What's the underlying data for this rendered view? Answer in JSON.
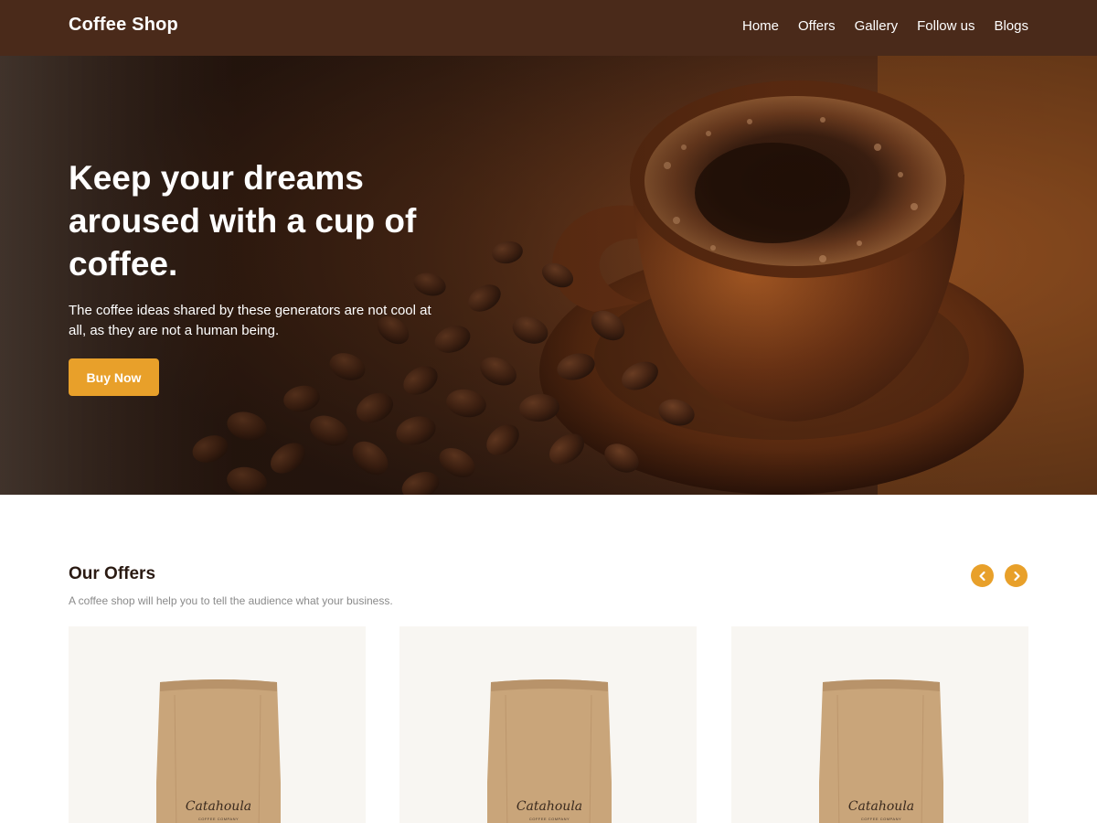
{
  "header": {
    "brand": "Coffee Shop",
    "nav": [
      "Home",
      "Offers",
      "Gallery",
      "Follow us",
      "Blogs"
    ]
  },
  "hero": {
    "title": "Keep your dreams aroused with a cup of coffee.",
    "text": "The coffee ideas shared by these generators are not cool at all, as they are not a human being.",
    "button": "Buy Now"
  },
  "offers": {
    "title": "Our Offers",
    "subtitle": "A coffee shop will help you to tell the audience what your business.",
    "prev_icon": "chevron-left-icon",
    "next_icon": "chevron-right-icon",
    "cards": [
      {
        "brand": "Catahoula",
        "sub": "COFFEE COMPANY"
      },
      {
        "brand": "Catahoula",
        "sub": "COFFEE COMPANY"
      },
      {
        "brand": "Catahoula",
        "sub": "COFFEE COMPANY"
      }
    ]
  },
  "colors": {
    "nav_bg": "#4a2a1a",
    "accent": "#e8a02a",
    "card_bg": "#f8f6f2"
  }
}
